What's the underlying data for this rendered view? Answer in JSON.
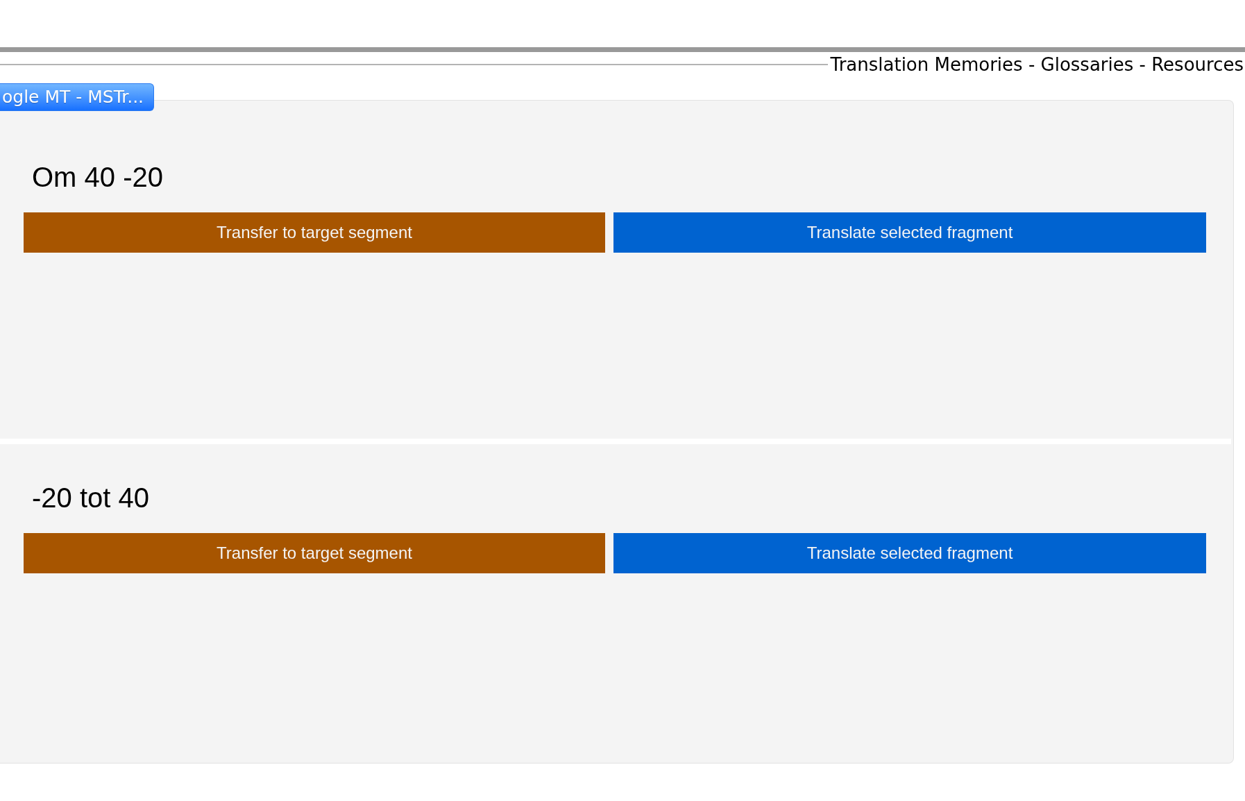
{
  "header": {
    "title": "Translation Memories - Glossaries - Resources"
  },
  "tabs": [
    {
      "label": "ogle MT - MSTr...",
      "selected": true
    }
  ],
  "results": [
    {
      "text": "Om 40 -20",
      "buttons": [
        {
          "kind": "transfer",
          "label": "Transfer to target segment"
        },
        {
          "kind": "translate",
          "label": "Translate selected fragment"
        }
      ]
    },
    {
      "text": "-20 tot 40",
      "buttons": [
        {
          "kind": "transfer",
          "label": "Transfer to target segment"
        },
        {
          "kind": "translate",
          "label": "Translate selected fragment"
        }
      ]
    }
  ]
}
